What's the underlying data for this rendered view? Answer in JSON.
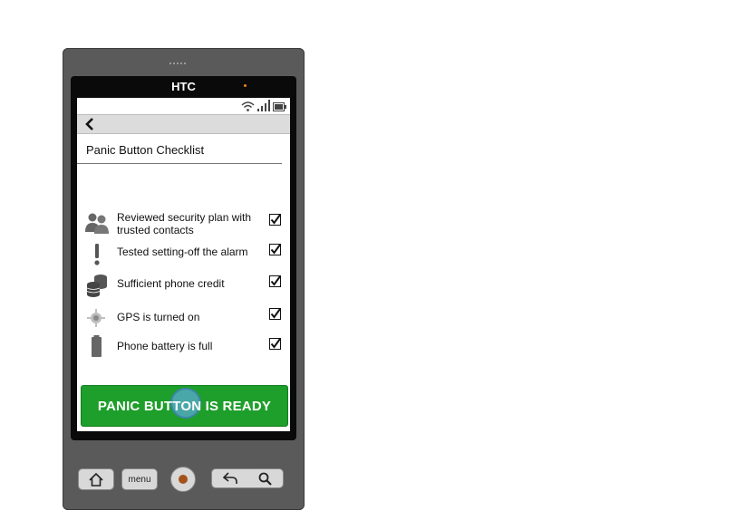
{
  "device": {
    "brand": "HTC"
  },
  "screen": {
    "title": "Panic Button Checklist",
    "checklist": [
      {
        "label": "Reviewed security plan with trusted contacts",
        "icon": "people-icon",
        "checked": true
      },
      {
        "label": "Tested setting-off the alarm",
        "icon": "exclamation-icon",
        "checked": true
      },
      {
        "label": "Sufficient phone credit",
        "icon": "coins-icon",
        "checked": true
      },
      {
        "label": "GPS is turned on",
        "icon": "gps-icon",
        "checked": true
      },
      {
        "label": "Phone battery is full",
        "icon": "battery-icon",
        "checked": true
      }
    ],
    "panic_button": {
      "label": "PANIC BUTTON IS READY",
      "color": "#1e9e2b"
    }
  },
  "hardware": {
    "menu_label": "menu"
  }
}
